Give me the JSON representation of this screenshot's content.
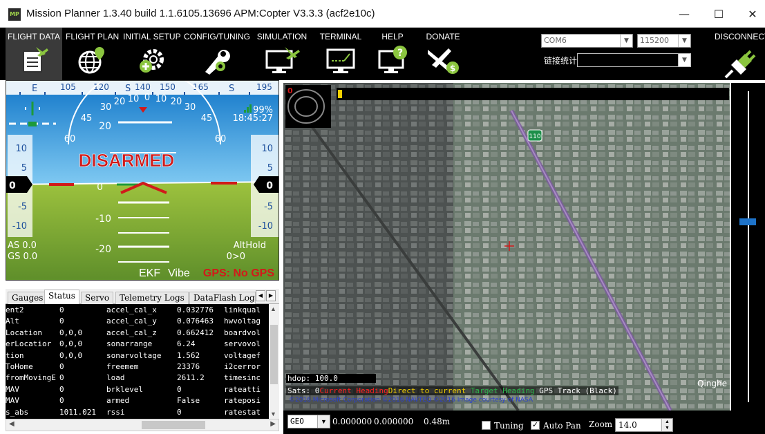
{
  "window": {
    "title": "Mission Planner 1.3.40 build 1.1.6105.13696 APM:Copter V3.3.3 (acf2e10c)",
    "app_icon_text": "MP",
    "minimize": "—",
    "maximize": "☐",
    "close": "✕"
  },
  "menu": {
    "items": [
      {
        "label": "FLIGHT DATA",
        "icon": "flight-data-icon"
      },
      {
        "label": "FLIGHT PLAN",
        "icon": "flight-plan-globe-icon"
      },
      {
        "label": "INITIAL SETUP",
        "icon": "initial-setup-gear-icon"
      },
      {
        "label": "CONFIG/TUNING",
        "icon": "config-wrench-icon"
      },
      {
        "label": "SIMULATION",
        "icon": "simulation-monitor-icon"
      },
      {
        "label": "TERMINAL",
        "icon": "terminal-monitor-icon"
      },
      {
        "label": "HELP",
        "icon": "help-monitor-icon"
      },
      {
        "label": "DONATE",
        "icon": "donate-plane-icon"
      }
    ],
    "disconnect_label": "DISCONNECT",
    "port": "COM6",
    "baud": "115200",
    "stats_label": "链接统计"
  },
  "hud": {
    "heading_ticks": [
      "E",
      "105",
      "120",
      "S",
      "140",
      "150",
      "165",
      "S",
      "195"
    ],
    "pitch_labels": [
      "20",
      "0",
      "-10",
      "-20"
    ],
    "roll_labels": [
      "60",
      "45",
      "30",
      "20",
      "10",
      "0",
      "10",
      "20",
      "30",
      "45",
      "60"
    ],
    "left_tape": [
      "10",
      "5",
      "0",
      "-5",
      "-10"
    ],
    "right_tape": [
      "10",
      "5",
      "0",
      "-5",
      "-10"
    ],
    "armed_status": "DISARMED",
    "battery": "99%",
    "time": "18:45:27",
    "airspeed": "AS 0.0",
    "groundspeed": "GS 0.0",
    "mode": "AltHold",
    "wp": "0>0",
    "ekf": "EKF",
    "vibe": "Vibe",
    "gps": "GPS: No GPS",
    "colors": {
      "sky": "#2a8fd8",
      "ground": "#7fa935",
      "warning": "#d11a1a"
    }
  },
  "tabs": [
    "Gauges",
    "Status",
    "Servo",
    "Telemetry Logs",
    "DataFlash Log"
  ],
  "tabs_active": "Status",
  "status_rows": [
    [
      "ent2",
      "0",
      "accel_cal_x",
      "0.032776",
      "linkqual"
    ],
    [
      "Alt",
      "0",
      "accel_cal_y",
      "0.076463",
      "hwvoltag"
    ],
    [
      "Location",
      "0,0,0",
      "accel_cal_z",
      "0.662412",
      "boardvol"
    ],
    [
      "erLocatior",
      "0,0,0",
      "sonarrange",
      "6.24",
      "servovol"
    ],
    [
      "tion",
      "0,0,0",
      "sonarvoltage",
      "1.562",
      "voltagef"
    ],
    [
      "ToHome",
      "0",
      "freemem",
      "23376",
      "i2cerror"
    ],
    [
      "fromMovingE",
      "0",
      "load",
      "2611.2",
      "timesinc"
    ],
    [
      "MAV",
      "0",
      "brklevel",
      "0",
      "rateatti"
    ],
    [
      "MAV",
      "0",
      "armed",
      "False",
      "rateposi"
    ],
    [
      "s_abs",
      "1011.021",
      "rssi",
      "0",
      "ratestat"
    ]
  ],
  "map": {
    "heading_value": "0",
    "hdop": "hdop: 100.0",
    "sats_label": "Sats: 0",
    "current_heading": "Current Heading",
    "direct_to_current": "Direct to current",
    "target_heading": "Target Heading",
    "gps_track": "GPS Track (Black)",
    "copyright": "©2016 Microsoft Corporation ©2016 NAVTEQ ©2016 Image courtesy of NASA",
    "place_label": "Qinghe",
    "road_shield": "110"
  },
  "bottom": {
    "coord_type": "GEO",
    "lat": "0.000000",
    "lng": "0.000000",
    "alt": "0.48m",
    "tuning_label": "Tuning",
    "tuning_checked": false,
    "autopan_label": "Auto Pan",
    "autopan_checked": true,
    "zoom_label": "Zoom",
    "zoom_value": "14.0"
  }
}
